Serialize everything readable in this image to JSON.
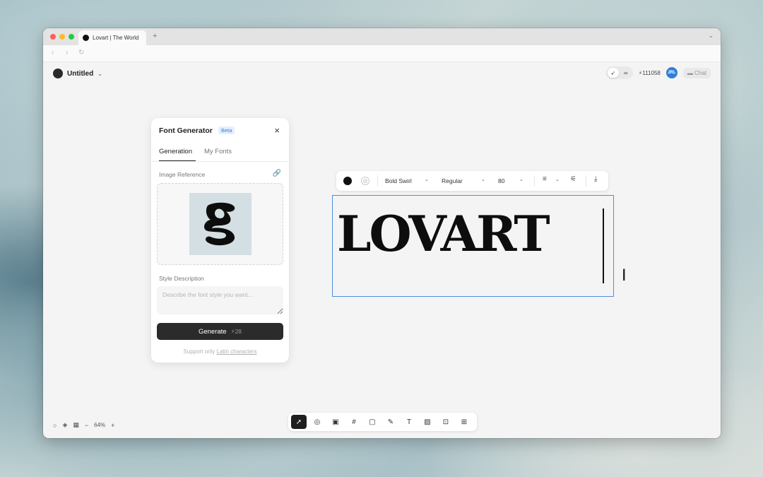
{
  "browser": {
    "tab_title": "Lovart | The World",
    "new_tab_symbol": "+",
    "nav_back": "‹",
    "nav_forward": "›",
    "nav_reload": "↻",
    "tabbar_menu": "⌄"
  },
  "header": {
    "project_name": "Untitled",
    "credits": "111058",
    "avatar_text": "JRL",
    "chat_label": "Chat",
    "mode_icons": [
      "rocket-icon",
      "infinity-icon"
    ]
  },
  "font_panel": {
    "title": "Font Generator",
    "badge": "Beta",
    "close_symbol": "×",
    "tabs": [
      "Generation",
      "My Fonts"
    ],
    "active_tab": "Generation",
    "image_reference_label": "Image Reference",
    "reference_glyph": "g",
    "style_description_label": "Style Description",
    "style_placeholder": "Describe the font style you want...",
    "generate_label": "Generate",
    "generate_cost": "28",
    "hint_prefix": "Support only ",
    "hint_link": "Latin characters"
  },
  "text_toolbar": {
    "fill_color": "#111111",
    "font_family": "Bold Swirl",
    "font_weight": "Regular",
    "font_size": "80",
    "icons": [
      "align-left-icon",
      "sliders-icon",
      "download-icon"
    ]
  },
  "canvas": {
    "text_content": "LOVART",
    "selection_color": "#4a90e2"
  },
  "bottom_left": {
    "zoom": "64%"
  },
  "tools": [
    {
      "name": "select-tool",
      "symbol": "➚",
      "active": true
    },
    {
      "name": "mark-tool",
      "symbol": "◎"
    },
    {
      "name": "image-tool",
      "symbol": "▣"
    },
    {
      "name": "frame-tool",
      "symbol": "#"
    },
    {
      "name": "shape-tool",
      "symbol": "▢"
    },
    {
      "name": "pen-tool",
      "symbol": "✎"
    },
    {
      "name": "text-tool",
      "symbol": "T"
    },
    {
      "name": "image-gen-tool",
      "symbol": "▨"
    },
    {
      "name": "video-gen-tool",
      "symbol": "⊡"
    },
    {
      "name": "font-gen-tool",
      "symbol": "⊞"
    }
  ]
}
